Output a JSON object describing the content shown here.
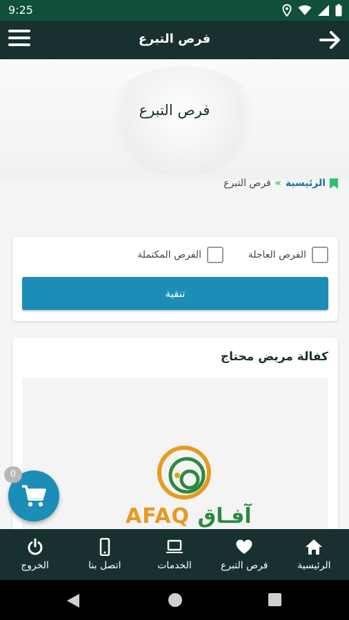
{
  "status_bar": {
    "time": "9:25",
    "icons": [
      "location-icon",
      "wifi-icon",
      "signal-icon",
      "battery-icon"
    ]
  },
  "app_bar": {
    "title": "فرص التبرع",
    "menu_icon": "menu-icon",
    "back_icon": "arrow-right-icon"
  },
  "hero": {
    "heading": "فرص التبرع"
  },
  "breadcrumb": {
    "home": "الرئيسية",
    "separator": "»",
    "current": "فرص التبرع"
  },
  "filters": {
    "urgent_label": "الفرص العاجلة",
    "completed_label": "الفرص المكتملة",
    "filter_button": "تنقية"
  },
  "opportunity": {
    "title": "كفالة مريض محتاج",
    "logo": {
      "latin": "AFAQ",
      "arabic": "آفـاق"
    }
  },
  "cart": {
    "count": "0"
  },
  "bottom_nav": [
    {
      "label": "الرئيسية",
      "icon": "home-icon"
    },
    {
      "label": "فرص التبرع",
      "icon": "heart-icon"
    },
    {
      "label": "الخدمات",
      "icon": "laptop-icon"
    },
    {
      "label": "اتصل بنا",
      "icon": "phone-icon"
    },
    {
      "label": "الخروج",
      "icon": "power-icon"
    }
  ],
  "colors": {
    "accent": "#1c8db6",
    "dark": "#18302f",
    "status": "#0f4f3c",
    "green": "#2cc36b"
  }
}
